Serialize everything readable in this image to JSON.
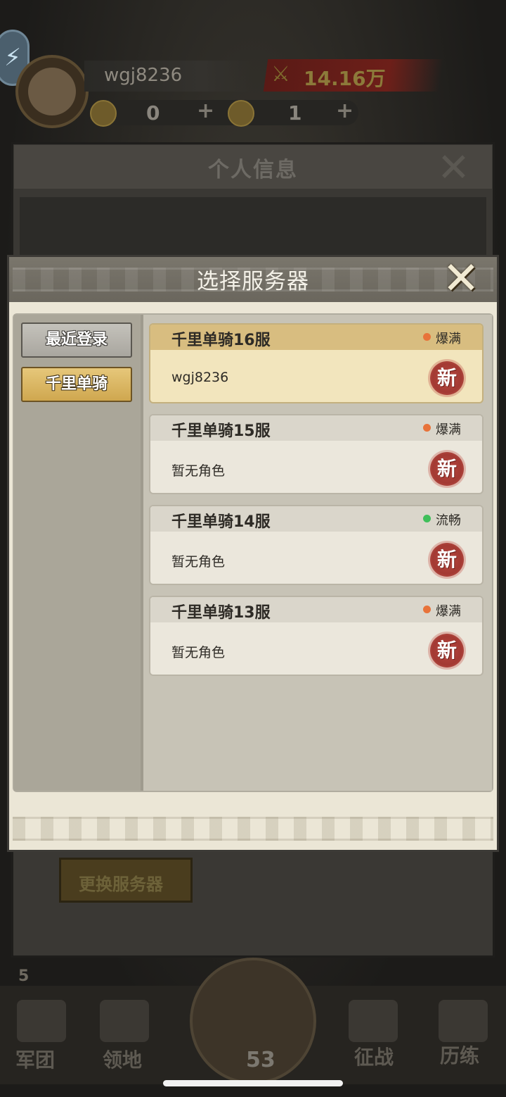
{
  "player": {
    "username": "wgj8236",
    "power": "14.16万",
    "silver": "0",
    "copper": "1",
    "plus": "+"
  },
  "info_panel": {
    "title": "个人信息",
    "change_server_label": "更换服务器"
  },
  "modal": {
    "title": "选择服务器",
    "close_icon": "✕",
    "tabs": [
      {
        "label": "最近登录"
      },
      {
        "label": "千里单骑"
      }
    ],
    "servers": [
      {
        "name": "千里单骑16服",
        "status": "爆满",
        "status_color": "#e8733a",
        "role": "wgj8236",
        "badge": "新",
        "selected": true
      },
      {
        "name": "千里单骑15服",
        "status": "爆满",
        "status_color": "#e8733a",
        "role": "暂无角色",
        "badge": "新",
        "selected": false
      },
      {
        "name": "千里单骑14服",
        "status": "流畅",
        "status_color": "#3fbf5a",
        "role": "暂无角色",
        "badge": "新",
        "selected": false
      },
      {
        "name": "千里单骑13服",
        "status": "爆满",
        "status_color": "#e8733a",
        "role": "暂无角色",
        "badge": "新",
        "selected": false
      }
    ]
  },
  "bottom_nav": {
    "level": "5",
    "energy": "53",
    "items": [
      {
        "label": "军团"
      },
      {
        "label": "领地"
      },
      {
        "label": "征战"
      },
      {
        "label": "历练"
      }
    ]
  }
}
